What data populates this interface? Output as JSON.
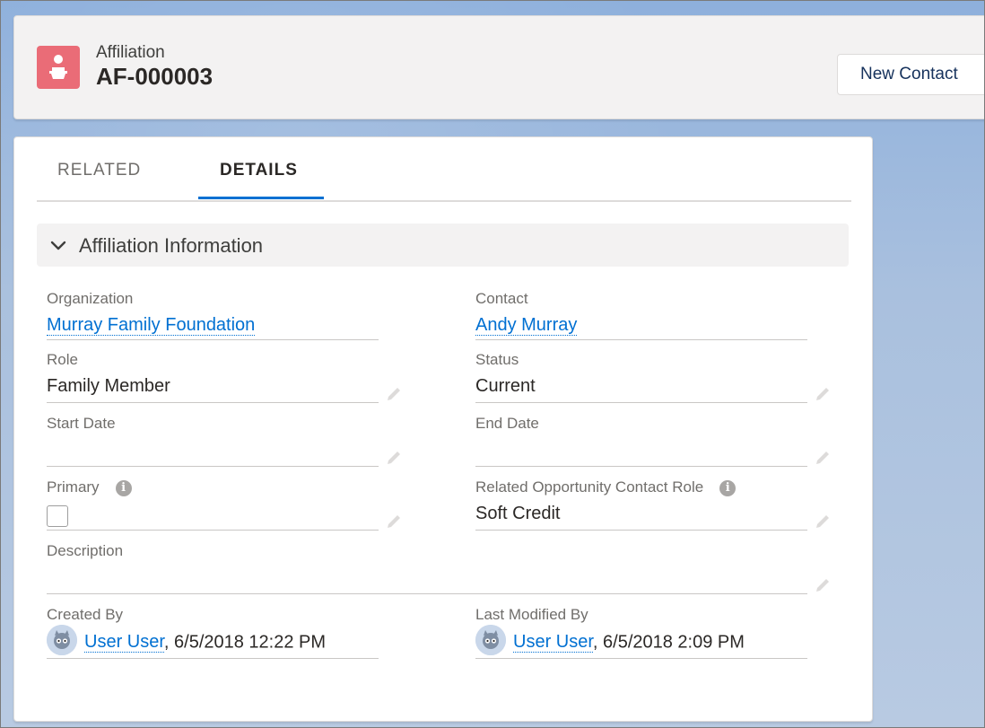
{
  "header": {
    "object_label": "Affiliation",
    "record_title": "AF-000003",
    "new_contact_label": "New Contact",
    "icon_color": "#ea6c77"
  },
  "tabs": [
    {
      "label": "RELATED",
      "active": false
    },
    {
      "label": "DETAILS",
      "active": true
    }
  ],
  "section": {
    "title": "Affiliation Information",
    "expanded": true
  },
  "fields": {
    "organization": {
      "label": "Organization",
      "value": "Murray Family Foundation",
      "is_link": true
    },
    "contact": {
      "label": "Contact",
      "value": "Andy Murray",
      "is_link": true
    },
    "role": {
      "label": "Role",
      "value": "Family Member"
    },
    "status": {
      "label": "Status",
      "value": "Current"
    },
    "start_date": {
      "label": "Start Date",
      "value": ""
    },
    "end_date": {
      "label": "End Date",
      "value": ""
    },
    "primary": {
      "label": "Primary",
      "checked": false
    },
    "related_opp_role": {
      "label": "Related Opportunity Contact Role",
      "value": "Soft Credit"
    },
    "description": {
      "label": "Description",
      "value": ""
    },
    "created_by": {
      "label": "Created By",
      "user": "User User",
      "timestamp": ", 6/5/2018 12:22 PM"
    },
    "last_modified_by": {
      "label": "Last Modified By",
      "user": "User User",
      "timestamp": ", 6/5/2018 2:09 PM"
    }
  },
  "colors": {
    "link": "#0070d2",
    "active_tab_underline": "#0070d2"
  }
}
